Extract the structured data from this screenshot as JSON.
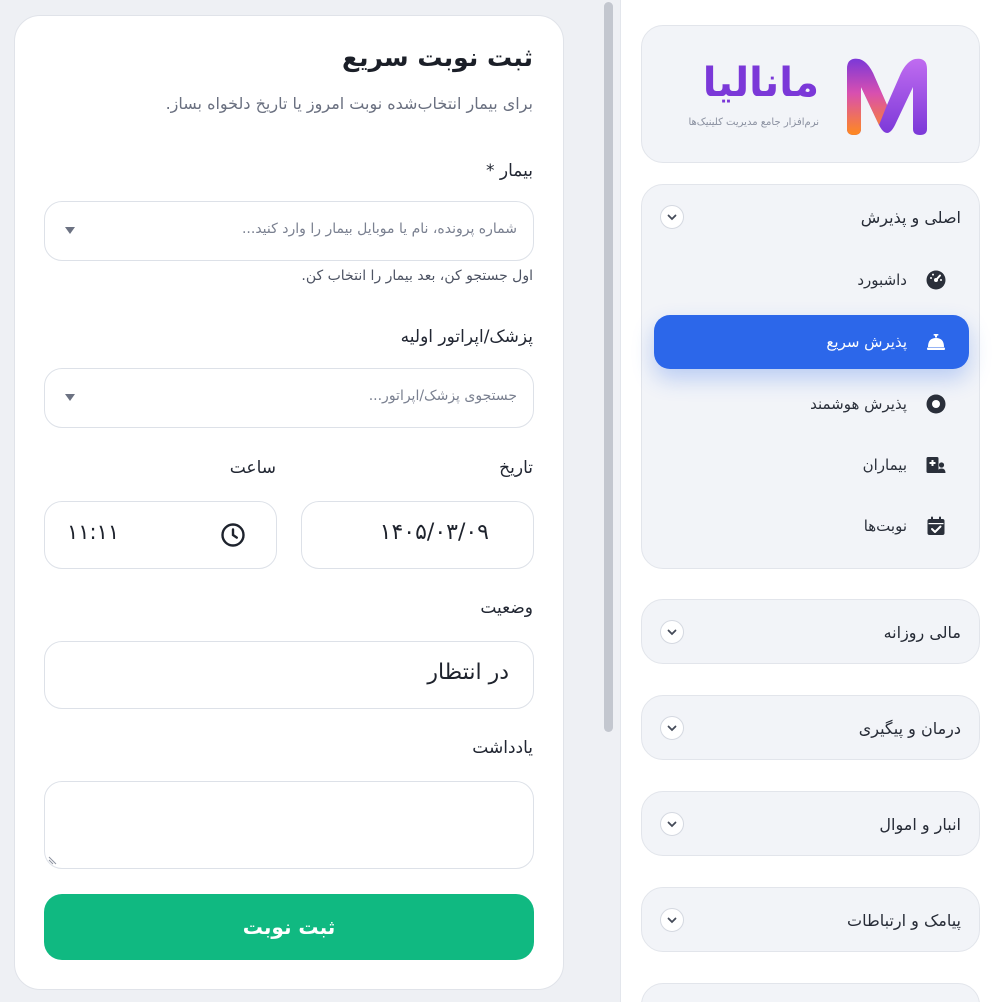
{
  "brand": {
    "name": "مانالیا",
    "tagline": "نرم‌افزار جامع مدیریت کلینیک‌ها",
    "colors": {
      "primary": "#7b38d8",
      "accent": "#ff8a1e"
    }
  },
  "sidebar": {
    "groups": [
      {
        "title": "اصلی و پذیرش",
        "expanded": true,
        "items": [
          {
            "label": "داشبورد",
            "icon": "dashboard-gauge-icon",
            "active": false
          },
          {
            "label": "پذیرش سریع",
            "icon": "reception-bell-icon",
            "active": true
          },
          {
            "label": "پذیرش هوشمند",
            "icon": "target-circle-icon",
            "active": false
          },
          {
            "label": "بیماران",
            "icon": "patients-id-icon",
            "active": false
          },
          {
            "label": "نوبت‌ها",
            "icon": "calendar-check-icon",
            "active": false
          }
        ]
      },
      {
        "title": "مالی روزانه",
        "expanded": false
      },
      {
        "title": "درمان و پیگیری",
        "expanded": false
      },
      {
        "title": "انبار و اموال",
        "expanded": false
      },
      {
        "title": "پیامک و ارتباطات",
        "expanded": false
      }
    ],
    "active_color": "#2c67ea"
  },
  "form": {
    "title": "ثبت نوبت سریع",
    "subtitle": "برای بیمار انتخاب‌شده نوبت امروز یا تاریخ دلخواه بساز.",
    "patient": {
      "label": "بیمار *",
      "placeholder": "شماره پرونده، نام یا موبایل بیمار را وارد کنید...",
      "hint": "اول جستجو کن، بعد بیمار را انتخاب کن."
    },
    "doctor": {
      "label": "پزشک/اپراتور اولیه",
      "placeholder": "جستجوی پزشک/اپراتور..."
    },
    "date": {
      "label": "تاریخ",
      "value": "۱۴۰۵/۰۳/۰۹"
    },
    "time": {
      "label": "ساعت",
      "value": "۱۱:۱۱"
    },
    "status": {
      "label": "وضعیت",
      "value": "در انتظار"
    },
    "note": {
      "label": "یادداشت",
      "value": ""
    },
    "submit_label": "ثبت نوبت",
    "submit_color": "#10b981"
  }
}
